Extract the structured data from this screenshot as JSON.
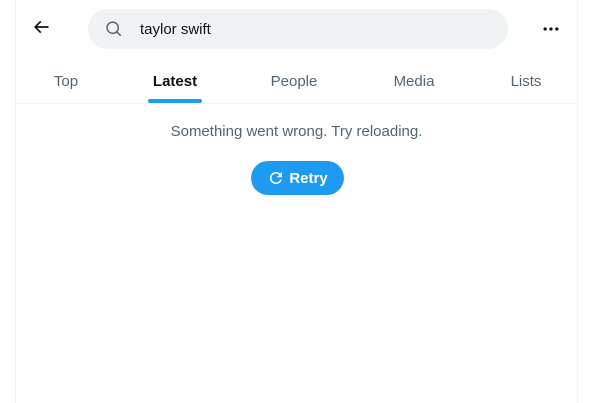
{
  "search": {
    "query": "taylor swift"
  },
  "tabs": [
    {
      "label": "Top"
    },
    {
      "label": "Latest"
    },
    {
      "label": "People"
    },
    {
      "label": "Media"
    },
    {
      "label": "Lists"
    }
  ],
  "active_tab": "Latest",
  "error": {
    "message": "Something went wrong. Try reloading.",
    "retry_label": "Retry"
  },
  "icons": {
    "back": "back-arrow-icon",
    "search": "search-icon",
    "more": "more-horizontal-icon",
    "retry": "refresh-icon"
  },
  "colors": {
    "accent": "#1d9bf0",
    "search_bg": "#eff3f4",
    "secondary_text": "#536471",
    "primary_text": "#0f1419"
  }
}
